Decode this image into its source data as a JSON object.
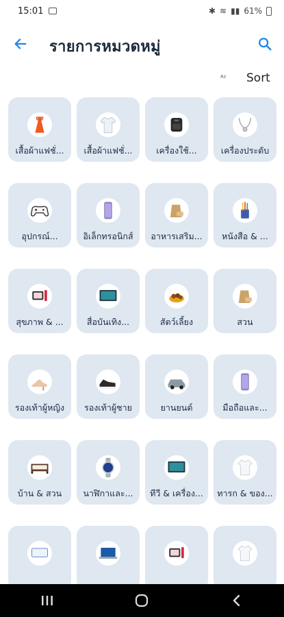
{
  "status_bar": {
    "time": "15:01",
    "battery": "61%"
  },
  "header": {
    "title": "รายการหมวดหมู่"
  },
  "sort": {
    "icon": "sort-az-icon",
    "icon_glyph": "ᴬᶻ",
    "label": "Sort"
  },
  "categories": [
    {
      "label": "เสื้อผ้าแฟชั่...",
      "icon": "dress-icon"
    },
    {
      "label": "เสื้อผ้าแฟชั่...",
      "icon": "shirt-icon"
    },
    {
      "label": "เครื่องใช้...",
      "icon": "air-fryer-icon"
    },
    {
      "label": "เครื่องประดับ",
      "icon": "necklace-icon"
    },
    {
      "label": "อุปกรณ์...",
      "icon": "game-controller-icon"
    },
    {
      "label": "อิเล็กทรอนิกส์",
      "icon": "smartphone-icon"
    },
    {
      "label": "อาหารเสริม...",
      "icon": "food-sack-icon"
    },
    {
      "label": "หนังสือ & ...",
      "icon": "pencil-cup-icon"
    },
    {
      "label": "สุขภาพ & ...",
      "icon": "cosmetics-icon"
    },
    {
      "label": "สื่อบันเทิง...",
      "icon": "tv-icon"
    },
    {
      "label": "สัตว์เลี้ยง",
      "icon": "pet-food-icon"
    },
    {
      "label": "สวน",
      "icon": "garden-sack-icon"
    },
    {
      "label": "รองเท้าผู้หญิง",
      "icon": "high-heels-icon"
    },
    {
      "label": "รองเท้าผู้ชาย",
      "icon": "sneaker-icon"
    },
    {
      "label": "ยานยนต์",
      "icon": "car-icon"
    },
    {
      "label": "มือถือและ...",
      "icon": "mobile-phone-icon"
    },
    {
      "label": "บ้าน & สวน",
      "icon": "bed-icon"
    },
    {
      "label": "นาฬิกาและ...",
      "icon": "watch-icon"
    },
    {
      "label": "ทีวี & เครื่อง...",
      "icon": "television-icon"
    },
    {
      "label": "ทารก & ของ...",
      "icon": "baby-clothes-icon"
    },
    {
      "label": "",
      "icon": "box-icon"
    },
    {
      "label": "",
      "icon": "laptop-icon"
    },
    {
      "label": "",
      "icon": "makeup-icon"
    },
    {
      "label": "",
      "icon": "onesie-icon"
    }
  ],
  "nav": {
    "recents": "recents-icon",
    "home": "home-icon",
    "back": "back-icon"
  }
}
